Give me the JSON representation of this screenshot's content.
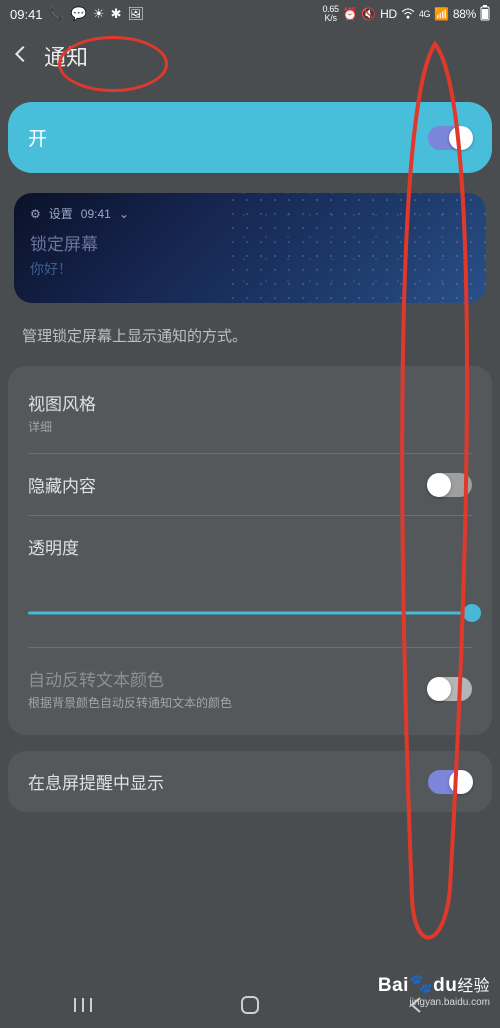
{
  "status": {
    "time": "09:41",
    "data_rate": "0.65",
    "data_unit": "K/s",
    "hd": "HD",
    "net": "4G",
    "battery": "88%"
  },
  "header": {
    "title": "通知"
  },
  "master_toggle": {
    "label": "开"
  },
  "preview": {
    "app": "设置",
    "time": "09:41",
    "title": "锁定屏幕",
    "sub": "你好！"
  },
  "desc": "管理锁定屏幕上显示通知的方式。",
  "rows": {
    "view_style_label": "视图风格",
    "view_style_value": "详细",
    "hide_content": "隐藏内容",
    "transparency": "透明度",
    "auto_invert_label": "自动反转文本颜色",
    "auto_invert_sub": "根据背景颜色自动反转通知文本的颜色",
    "aod_show": "在息屏提醒中显示"
  },
  "watermark": {
    "brand_a": "Bai",
    "brand_b": "du",
    "brand_c": "经验",
    "url": "jingyan.baidu.com"
  }
}
